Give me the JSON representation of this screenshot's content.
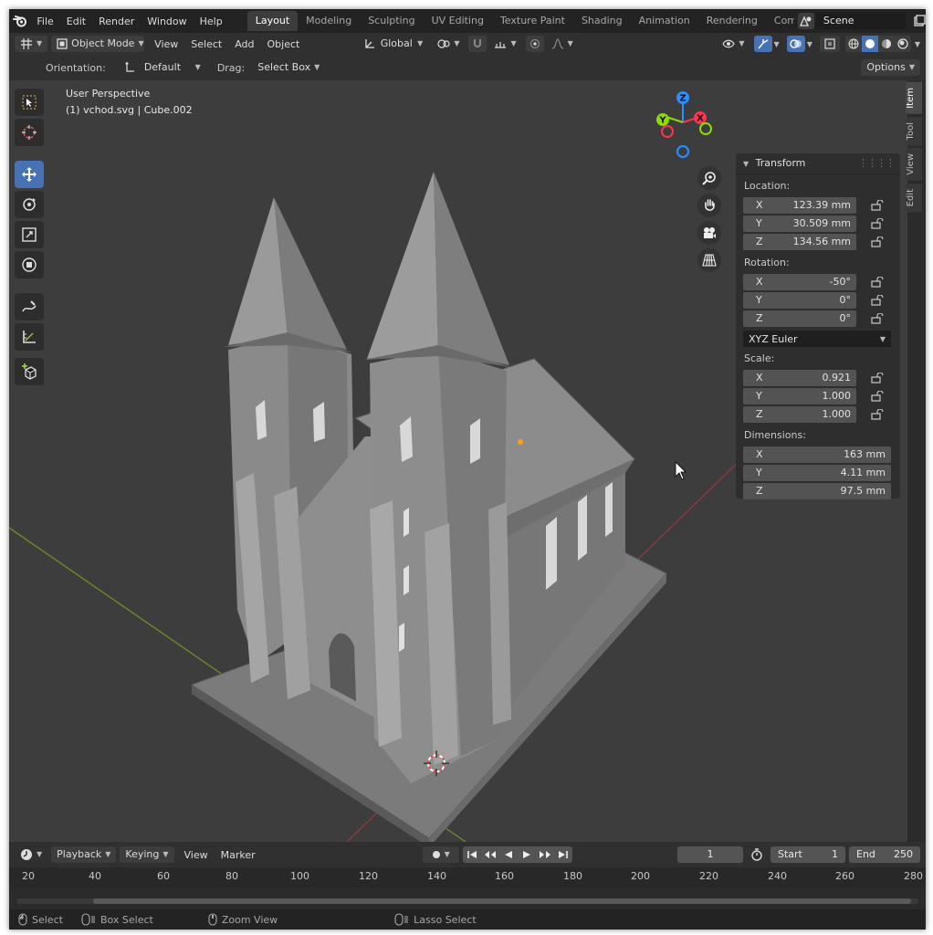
{
  "topbar": {
    "menus": [
      "File",
      "Edit",
      "Render",
      "Window",
      "Help"
    ],
    "workspaces": [
      "Layout",
      "Modeling",
      "Sculpting",
      "UV Editing",
      "Texture Paint",
      "Shading",
      "Animation",
      "Rendering",
      "Compo"
    ],
    "active_workspace": "Layout",
    "scene_name": "Scene"
  },
  "viewport_header": {
    "mode": "Object Mode",
    "menus": [
      "View",
      "Select",
      "Add",
      "Object"
    ],
    "transform_orientation": "Global"
  },
  "tool_settings": {
    "orientation_label": "Orientation:",
    "orientation_value": "Default",
    "drag_label": "Drag:",
    "drag_value": "Select Box",
    "options_label": "Options"
  },
  "viewport": {
    "view_name": "User Perspective",
    "object_info": "(1) vchod.svg | Cube.002",
    "gizmo_axes": {
      "x": "X",
      "y": "Y",
      "z": "Z"
    }
  },
  "npanel": {
    "title": "Transform",
    "location_label": "Location:",
    "location": [
      {
        "axis": "X",
        "value": "123.39 mm"
      },
      {
        "axis": "Y",
        "value": "30.509 mm"
      },
      {
        "axis": "Z",
        "value": "134.56 mm"
      }
    ],
    "rotation_label": "Rotation:",
    "rotation": [
      {
        "axis": "X",
        "value": "-50°"
      },
      {
        "axis": "Y",
        "value": "0°"
      },
      {
        "axis": "Z",
        "value": "0°"
      }
    ],
    "rotation_mode": "XYZ Euler",
    "scale_label": "Scale:",
    "scale": [
      {
        "axis": "X",
        "value": "0.921"
      },
      {
        "axis": "Y",
        "value": "1.000"
      },
      {
        "axis": "Z",
        "value": "1.000"
      }
    ],
    "dimensions_label": "Dimensions:",
    "dimensions": [
      {
        "axis": "X",
        "value": "163 mm"
      },
      {
        "axis": "Y",
        "value": "4.11 mm"
      },
      {
        "axis": "Z",
        "value": "97.5 mm"
      }
    ],
    "tabs": [
      "Item",
      "Tool",
      "View",
      "Edit"
    ]
  },
  "timeline": {
    "menus": [
      "Playback",
      "Keying",
      "View",
      "Marker"
    ],
    "current_frame": "1",
    "start_label": "Start",
    "start_value": "1",
    "end_label": "End",
    "end_value": "250",
    "ruler_ticks": [
      "20",
      "40",
      "60",
      "80",
      "100",
      "120",
      "140",
      "160",
      "180",
      "200",
      "220",
      "240",
      "260",
      "280"
    ]
  },
  "statusbar": {
    "items": [
      "Select",
      "Box Select",
      "Zoom View",
      "Lasso Select"
    ]
  },
  "colors": {
    "accent": "#4772b3",
    "axis_x": "#ff3352",
    "axis_y": "#8bdc00",
    "axis_z": "#2890ff",
    "viewport_bg": "#3d3d3d"
  }
}
